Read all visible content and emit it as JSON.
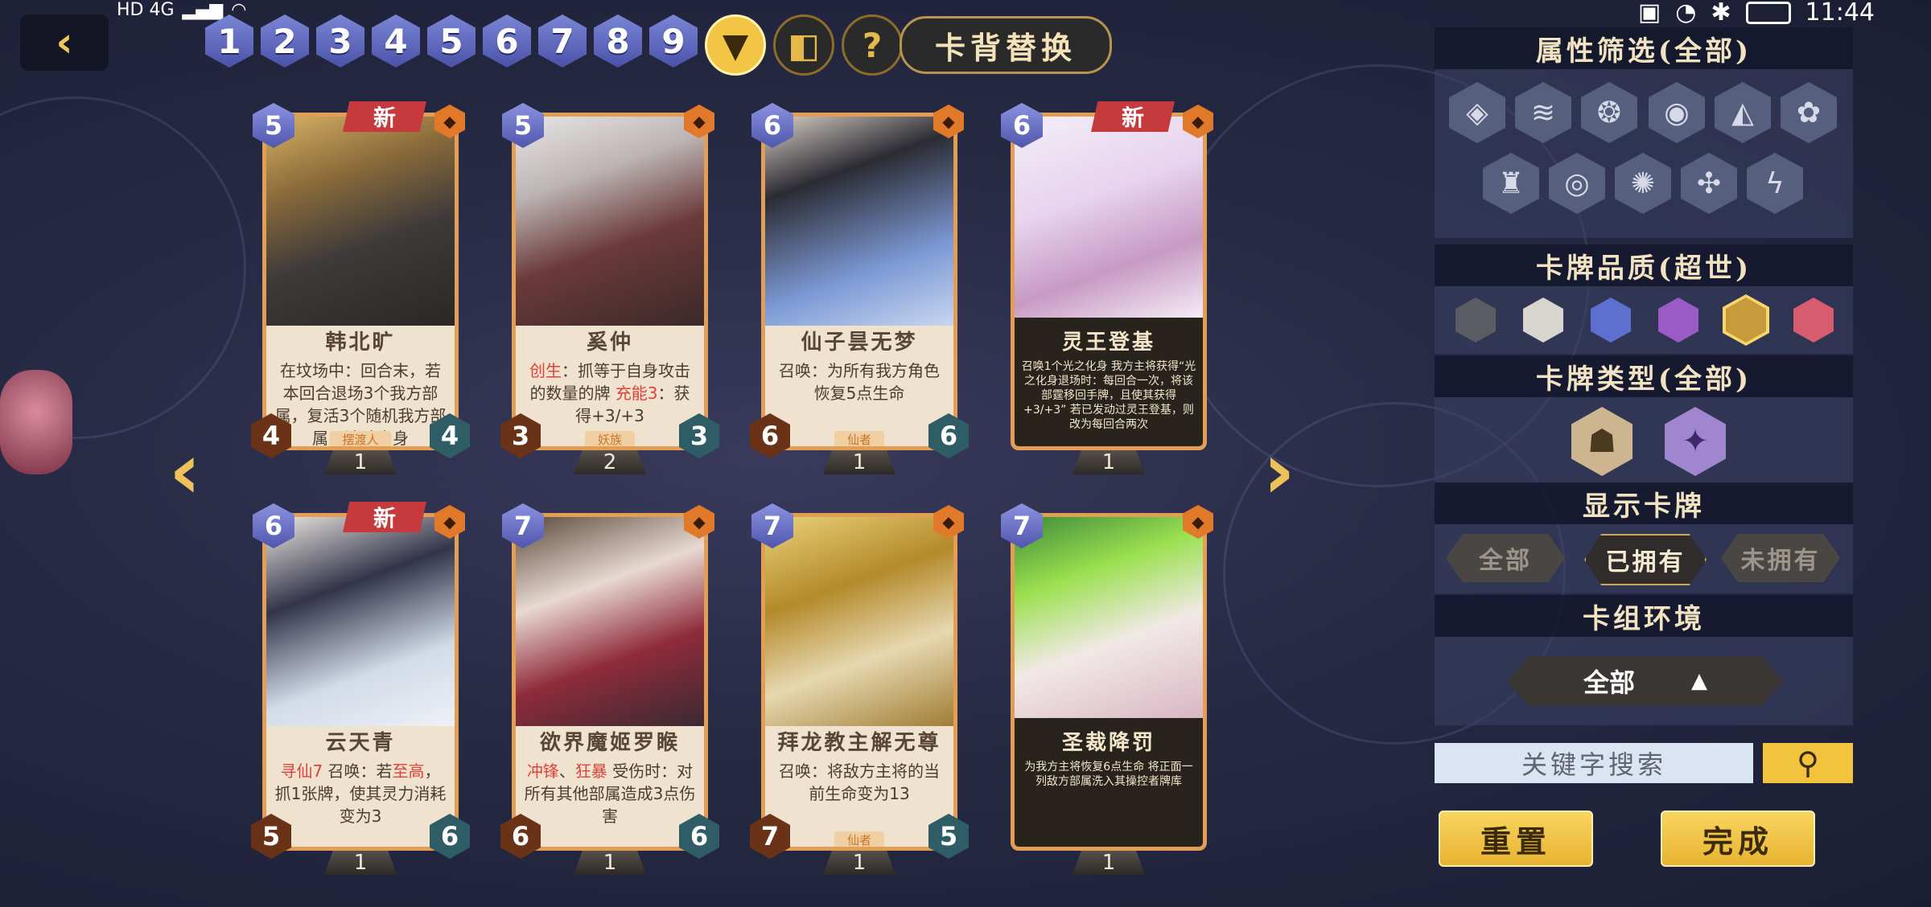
{
  "status_bar": {
    "left": "HD 4G",
    "time": "11:44"
  },
  "cost_filters": [
    "1",
    "2",
    "3",
    "4",
    "5",
    "6",
    "7",
    "8",
    "9"
  ],
  "toolbar": {
    "filter_icon": "filter-icon",
    "deck_icon": "deck-icon",
    "help_label": "?",
    "card_back_label": "卡背替换"
  },
  "cards": [
    {
      "cost": "5",
      "is_new": true,
      "new_label": "新",
      "name": "韩北旷",
      "desc": [
        {
          "t": "在坟场中：回合末，若本回合退场3个我方部属，复活3个随机我方部属，消除自身"
        }
      ],
      "race": "摆渡人",
      "atk": "4",
      "hp": "4",
      "count": "1",
      "dark": false
    },
    {
      "cost": "5",
      "is_new": false,
      "name": "奚仲",
      "desc": [
        {
          "t": "创生",
          "kw": true
        },
        {
          "t": "：抓等于自身攻击的数量的牌 "
        },
        {
          "t": "充能3",
          "kw": true
        },
        {
          "t": "：获得+3/+3"
        }
      ],
      "race": "妖族",
      "atk": "3",
      "hp": "3",
      "count": "2",
      "dark": false
    },
    {
      "cost": "6",
      "is_new": false,
      "name": "仙子昙无梦",
      "desc": [
        {
          "t": "召唤：为所有我方角色恢复5点生命"
        }
      ],
      "race": "仙者",
      "atk": "6",
      "hp": "6",
      "count": "1",
      "dark": false
    },
    {
      "cost": "6",
      "is_new": true,
      "new_label": "新",
      "name": "灵王登基",
      "desc": [
        {
          "t": "召唤1个光之化身 我方主将获得“光之化身退场时：每回合一次，将该部霆移回手牌，且使其获得+3/+3” 若已发动过灵王登基，则改为每回合两次"
        }
      ],
      "race": "",
      "atk": "",
      "hp": "",
      "count": "1",
      "dark": true
    },
    {
      "cost": "6",
      "is_new": true,
      "new_label": "新",
      "name": "云天青",
      "desc": [
        {
          "t": "寻仙7",
          "kw": true
        },
        {
          "t": " 召唤：若"
        },
        {
          "t": "至高",
          "kw": true
        },
        {
          "t": "，抓1张牌，使其灵力消耗变为3"
        }
      ],
      "race": "",
      "atk": "5",
      "hp": "6",
      "count": "1",
      "dark": false
    },
    {
      "cost": "7",
      "is_new": false,
      "name": "欲界魔姬罗睺",
      "desc": [
        {
          "t": "冲锋",
          "kw": true
        },
        {
          "t": "、"
        },
        {
          "t": "狂暴",
          "kw": true
        },
        {
          "t": " 受伤时：对所有其他部属造成3点伤害"
        }
      ],
      "race": "",
      "atk": "6",
      "hp": "6",
      "count": "1",
      "dark": false
    },
    {
      "cost": "7",
      "is_new": false,
      "name": "拜龙教主解无尊",
      "desc": [
        {
          "t": "召唤：将敌方主将的当前生命变为13"
        }
      ],
      "race": "仙者",
      "atk": "7",
      "hp": "5",
      "count": "1",
      "dark": false
    },
    {
      "cost": "7",
      "is_new": false,
      "name": "圣裁降罚",
      "desc": [
        {
          "t": "为我方主将恢复6点生命 将正面一列敌方部属洗入其操控者牌库"
        }
      ],
      "race": "",
      "atk": "",
      "hp": "",
      "count": "1",
      "dark": true
    }
  ],
  "panel": {
    "attr_title": "属性筛选(全部)",
    "quality_title": "卡牌品质(超世)",
    "type_title": "卡牌类型(全部)",
    "show_title": "显示卡牌",
    "show_options": [
      "全部",
      "已拥有",
      "未拥有"
    ],
    "deck_env_title": "卡组环境",
    "deck_env_value": "全部",
    "search_placeholder": "关键字搜索",
    "reset_label": "重置",
    "done_label": "完成"
  },
  "colors": {
    "accent_gold": "#f3c545",
    "card_border": "#e39e55",
    "keyword_red": "#e0413a",
    "quality": [
      "#5a5d63",
      "#d8d5cf",
      "#5d6fcf",
      "#9a5bc6",
      "#c79a3c",
      "#d65c6e"
    ]
  }
}
